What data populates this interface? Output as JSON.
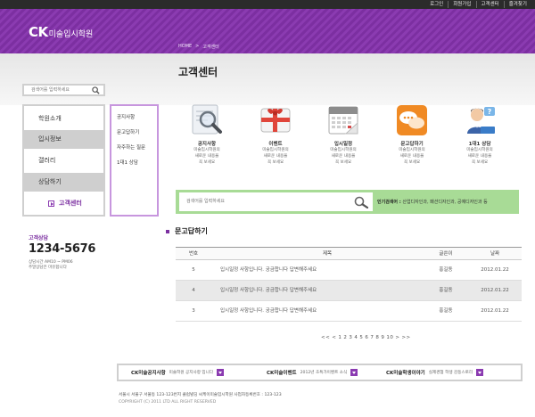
{
  "colors": {
    "purple": "#8b3bb1",
    "green": "#a8db96",
    "dark": "#2b2b2b"
  },
  "util_links": [
    "로그인",
    "회원가입",
    "고객센터",
    "즐겨찾기"
  ],
  "logo": {
    "ck": "CK",
    "name": "미술입시학원"
  },
  "breadcrumb": [
    "HOME",
    ">",
    "고객센터"
  ],
  "page_title": "고객센터",
  "sidebar": {
    "search_placeholder": "검색어를 입력하세요",
    "menu": [
      "학원소개",
      "입시정보",
      "갤러리",
      "상담하기",
      "고객센터"
    ],
    "submenu": [
      "공지사항",
      "문고답하기",
      "자주하는 질문",
      "1대1 상담"
    ],
    "support_title": "고객상담",
    "support_number": "1234-5676",
    "support_hours": "상담시간 AM10 ~ PM06",
    "support_note": "주말상담은 마유합니다"
  },
  "icons": [
    {
      "icon": "magnifier-icon",
      "label": "공지사항",
      "desc": [
        "미술입시학원의",
        "새로운 내용을",
        "꼭 보세요"
      ]
    },
    {
      "icon": "gift-icon",
      "label": "이벤트",
      "desc": [
        "미술입시학원의",
        "새로운 내용을",
        "꼭 보세요"
      ]
    },
    {
      "icon": "calendar-icon",
      "label": "입시일정",
      "desc": [
        "미술입시학원의",
        "새로운 내용을",
        "꼭 보세요"
      ]
    },
    {
      "icon": "chat-icon",
      "label": "문고답하기",
      "desc": [
        "미술입시학원의",
        "새로운 내용을",
        "꼭 보세요"
      ]
    },
    {
      "icon": "support-person-icon",
      "label": "1대1 상담",
      "desc": [
        "미술입시학원의",
        "새로운 내용을",
        "꼭 보세요"
      ]
    }
  ],
  "main_search": {
    "placeholder": "검색어를 입력하세요",
    "popular_label": "인기검색어 :",
    "popular_terms": "산업디자인과, 패션디자인과, 공예디자인과 등"
  },
  "section_title": "문고답하기",
  "table": {
    "headers": [
      "번호",
      "제목",
      "글쓴이",
      "날짜"
    ],
    "rows": [
      {
        "no": "5",
        "title": "입시일정 사항입니다. 궁금합니다 답변해주세요",
        "author": "홍길동",
        "date": "2012.01.22"
      },
      {
        "no": "4",
        "title": "입시일정 사항입니다. 궁금합니다 답변해주세요",
        "author": "홍길동",
        "date": "2012.01.22"
      },
      {
        "no": "3",
        "title": "입시일정 사항입니다. 궁금합니다 답변해주세요",
        "author": "홍길동",
        "date": "2012.01.22"
      }
    ]
  },
  "pagination": {
    "first": "<<",
    "prev": "<",
    "pages": [
      "1",
      "2",
      "3",
      "4",
      "5",
      "6",
      "7",
      "8",
      "9",
      "10"
    ],
    "next": ">",
    "last": ">>"
  },
  "bottom_bar": [
    {
      "title": "CK미술공지사항",
      "desc": "미술학원 공지사항 입니다"
    },
    {
      "title": "CK미술이벤트",
      "desc": "2012년 초특가이벤트 소식"
    },
    {
      "title": "CK미술학생이야기",
      "desc": "실제경험 학생 감동스토리"
    }
  ],
  "footer": {
    "address": "서울시 서울구 서울동 123-123번지 클럽빌딩 씨케이미술입시학원 사업자등록번호 : 123-123",
    "copyright": "COPYRIGHT (C) 2011 LTD ALL RIGHT RESERVED"
  }
}
